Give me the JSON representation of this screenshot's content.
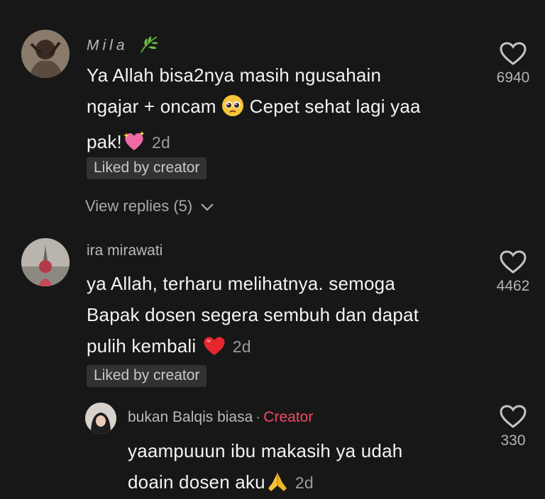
{
  "comments": [
    {
      "username": "Mila",
      "username_icon": "leaf-emoji",
      "lines": [
        "Ya Allah bisa2nya masih ngusahain",
        "ngajar + oncam",
        "Cepet sehat lagi yaa",
        "pak!"
      ],
      "emojis": [
        "pleading-face-emoji",
        "sparkling-heart-emoji"
      ],
      "time": "2d",
      "badge": "Liked by creator",
      "likes": "6940",
      "view_replies": "View replies (5)"
    },
    {
      "username": "ira mirawati",
      "lines": [
        "ya Allah, terharu melihatnya. semoga",
        "Bapak dosen segera sembuh dan dapat",
        "pulih kembali"
      ],
      "emojis": [
        "red-heart-emoji"
      ],
      "time": "2d",
      "badge": "Liked by creator",
      "likes": "4462"
    }
  ],
  "reply": {
    "username": "bukan Balqis biasa",
    "separator": "·",
    "creator_label": "Creator",
    "lines": [
      "yaampuuun ibu makasih ya udah",
      "doain dosen aku"
    ],
    "emojis": [
      "folded-hands-emoji"
    ],
    "time": "2d",
    "likes": "330"
  },
  "colors": {
    "background": "#171717",
    "creator_accent": "#f04a67",
    "badge_bg": "#323232"
  }
}
